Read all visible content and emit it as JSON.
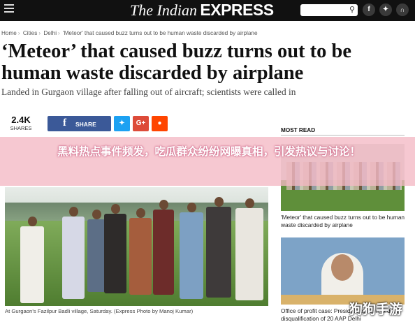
{
  "header": {
    "logo_the": "The Indian",
    "logo_express": "EXPRESS",
    "social": {
      "facebook": "f",
      "twitter": "t",
      "rss": "rss"
    }
  },
  "breadcrumb": [
    "Home",
    "Cities",
    "Delhi",
    "'Meteor' that caused buzz turns out to be human waste discarded by airplane"
  ],
  "article": {
    "headline": "‘Meteor’ that caused buzz turns out to be human waste discarded by airplane",
    "subhead": "Landed in Gurgaon village after falling out of aircraft; scientists were called in",
    "shares": {
      "count": "2.4K",
      "label": "SHARES"
    },
    "share_buttons": {
      "facebook": "SHARE",
      "google_plus": "G+"
    },
    "photo_caption": "At Gurgaon's Fazilpur Badli village, Saturday. (Express Photo by Manoj Kumar)"
  },
  "sidebar": {
    "section_title": "MOST READ",
    "items": [
      {
        "text": "'Meteor' that caused buzz turns out to be human waste discarded by airplane"
      },
      {
        "text": "Office of profit case: Preside... opinion, orders disqualification of 20 AAP Delhi"
      }
    ]
  },
  "overlay": {
    "banner": "黑料热点事件频发，吃瓜群众纷纷网曝真相，引发热议与讨论！",
    "watermark": "狗狗手游"
  },
  "colors": {
    "topbar": "#111111",
    "facebook": "#3b5998",
    "twitter": "#1da1f2",
    "google_plus": "#dd4b39",
    "reddit": "#ff4500",
    "banner": "#f4b8c4"
  }
}
